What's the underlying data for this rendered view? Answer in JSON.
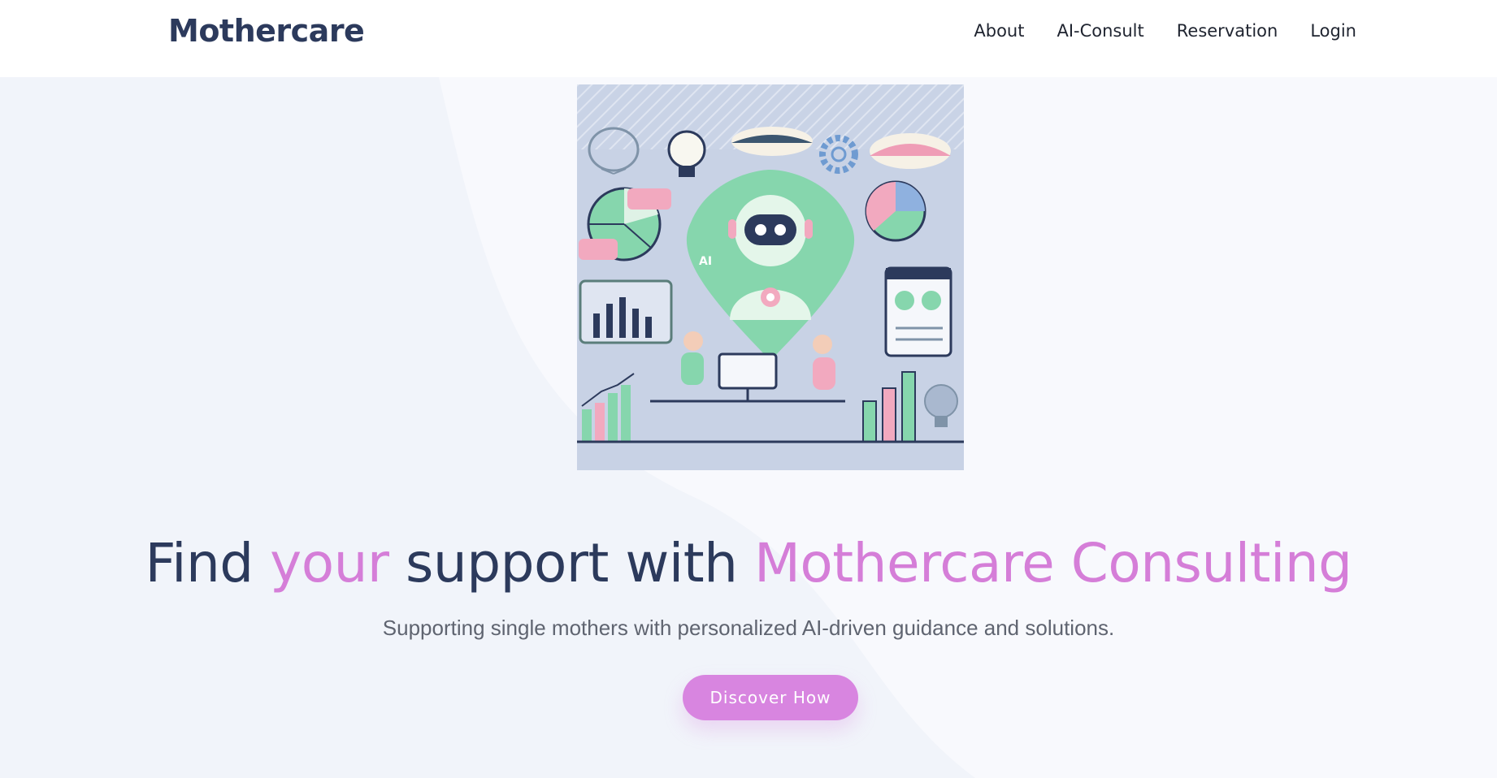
{
  "brand": {
    "name": "Mothercare"
  },
  "nav": {
    "items": [
      {
        "label": "About"
      },
      {
        "label": "AI-Consult"
      },
      {
        "label": "Reservation"
      },
      {
        "label": "Login"
      }
    ]
  },
  "hero": {
    "headline": {
      "part1": "Find ",
      "accent1": "your",
      "part2": " support with ",
      "accent2": "Mothercare Consulting"
    },
    "subtitle": "Supporting single mothers with personalized AI-driven guidance and solutions.",
    "cta_label": "Discover How",
    "illustration_text": {
      "ai_label": "AI"
    }
  },
  "colors": {
    "brand_navy": "#2c3a5c",
    "accent_pink": "#d57ed8",
    "button_pink": "#d885e0",
    "hero_bg": "#f1f4fa",
    "illustration_bg": "#c9d3e6",
    "mint": "#7fd1a6",
    "soft_pink": "#f0a6be"
  }
}
